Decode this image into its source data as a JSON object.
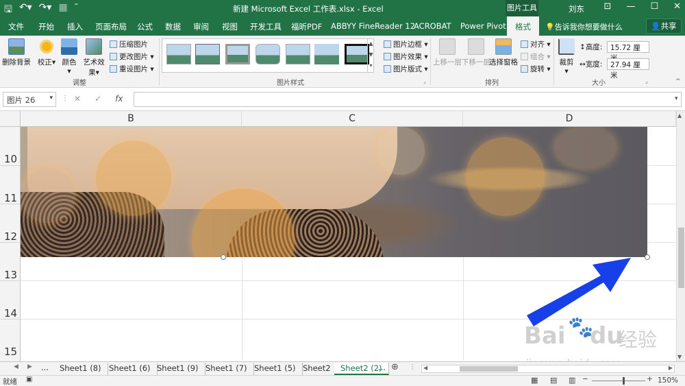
{
  "app": {
    "title": "新建 Microsoft Excel 工作表.xlsx  -  Excel",
    "context_tab_group": "图片工具",
    "user": "刘东"
  },
  "tabs": [
    {
      "label": "文件"
    },
    {
      "label": "开始"
    },
    {
      "label": "插入"
    },
    {
      "label": "页面布局"
    },
    {
      "label": "公式"
    },
    {
      "label": "数据"
    },
    {
      "label": "审阅"
    },
    {
      "label": "视图"
    },
    {
      "label": "开发工具"
    },
    {
      "label": "福昕PDF"
    },
    {
      "label": "ABBYY FineReader 12"
    },
    {
      "label": "ACROBAT"
    },
    {
      "label": "Power Pivot"
    },
    {
      "label": "格式"
    }
  ],
  "tell_me": "告诉我你想要做什么",
  "share": "共享",
  "ribbon": {
    "remove_bg": "删除背景",
    "correct": "校正",
    "color": "颜色",
    "artistic": "艺术效果",
    "compress": "压缩图片",
    "change": "更改图片",
    "reset": "重设图片",
    "group_adjust": "调整",
    "border": "图片边框",
    "effects": "图片效果",
    "layout": "图片版式",
    "group_styles": "图片样式",
    "bring_forward": "上移一层",
    "send_backward": "下移一层",
    "selection_pane": "选择窗格",
    "align": "对齐",
    "group": "组合",
    "rotate": "旋转",
    "group_arrange": "排列",
    "crop": "裁剪",
    "height_label": "高度:",
    "height_value": "15.72 厘米",
    "width_label": "宽度:",
    "width_value": "27.94 厘米",
    "group_size": "大小"
  },
  "formula_bar": {
    "name_box": "图片 26",
    "cancel": "✕",
    "enter": "✓",
    "fx": "fx",
    "value": ""
  },
  "columns": [
    "B",
    "C",
    "D"
  ],
  "rows": [
    "10",
    "11",
    "12",
    "13",
    "14",
    "15"
  ],
  "sheets": [
    "Sheet1 (8)",
    "Sheet1 (6)",
    "Sheet1 (9)",
    "Sheet1 (7)",
    "Sheet1 (5)",
    "Sheet2",
    "Sheet2 (2)"
  ],
  "sheets_more": "...",
  "status": {
    "ready": "就绪",
    "zoom": "150%"
  },
  "watermark": {
    "brand": "Bai",
    "brand2": "du",
    "cn": "经验",
    "url": "jingyan.baidu.com"
  },
  "colors": {
    "excel_green": "#217346",
    "arrow_blue": "#1740e8"
  }
}
